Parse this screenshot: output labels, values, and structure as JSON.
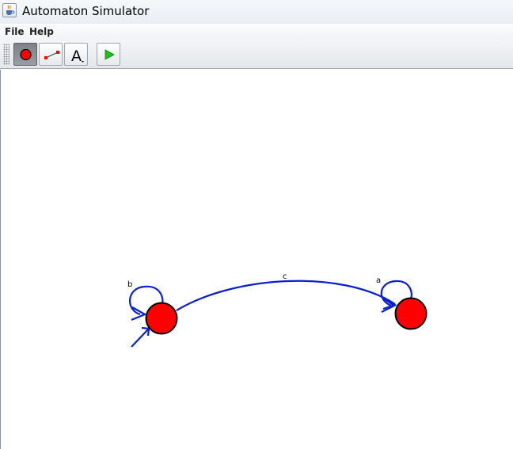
{
  "window": {
    "title": "Automaton Simulator",
    "icon": "java-cup-icon"
  },
  "menu": {
    "items": [
      {
        "label": "File"
      },
      {
        "label": "Help"
      }
    ]
  },
  "toolbar": {
    "tools": [
      {
        "name": "add-state-tool",
        "icon": "red-circle-icon",
        "selected": true
      },
      {
        "name": "add-transition-tool",
        "icon": "transition-line-icon",
        "selected": false
      },
      {
        "name": "label-tool",
        "icon": "letter-a-icon",
        "glyph": "A",
        "selected": false
      },
      {
        "name": "simulate-tool",
        "icon": "play-icon",
        "selected": false
      }
    ]
  },
  "colors": {
    "state_fill": "#ff0000",
    "state_stroke": "#000000",
    "transition": "#0b1fcf",
    "play": "#19c419"
  },
  "automaton": {
    "states": [
      {
        "id": "left-state",
        "initial": true
      },
      {
        "id": "right-state",
        "initial": false
      }
    ],
    "transitions": [
      {
        "from": "left-state",
        "to": "left-state",
        "label": "b"
      },
      {
        "from": "left-state",
        "to": "right-state",
        "label": "c"
      },
      {
        "from": "right-state",
        "to": "right-state",
        "label": "a"
      }
    ]
  }
}
